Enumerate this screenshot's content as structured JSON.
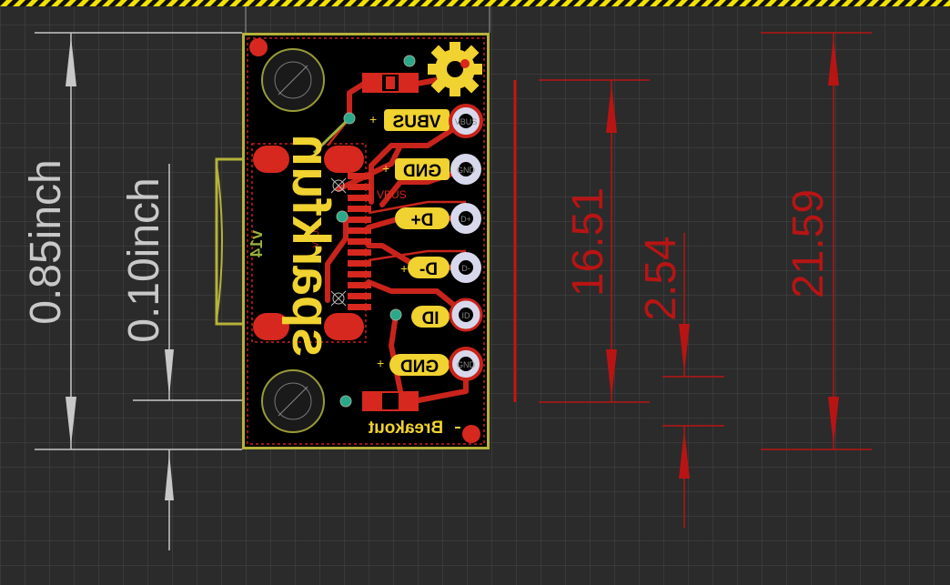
{
  "dimensions": {
    "board_height_in": "0.85inch",
    "pin_pitch_in": "0.10inch",
    "pin_span_mm": "16.51",
    "pitch_mm": "2.54",
    "board_height_mm": "21.59"
  },
  "silkscreen": {
    "pin_labels": [
      "VBUS",
      "GND",
      "D+",
      "D-",
      "ID",
      "GND"
    ],
    "pad_labels": [
      "VBUS",
      "GND",
      "D+",
      "D-",
      "ID",
      "GND"
    ],
    "brand": "sparkfun",
    "product": "Breakout",
    "version": "v14",
    "net_label": "VBUS",
    "small_net_label": "VBUS"
  },
  "colors": {
    "background": "#2b2b2b",
    "grid": "#444444",
    "board_outline": "#b6b23a",
    "copper": "#d6281e",
    "silk": "#f0d230",
    "dimension_white": "#c8c8c8",
    "dimension_red": "#b81414",
    "pad": "#d8d8ec"
  }
}
